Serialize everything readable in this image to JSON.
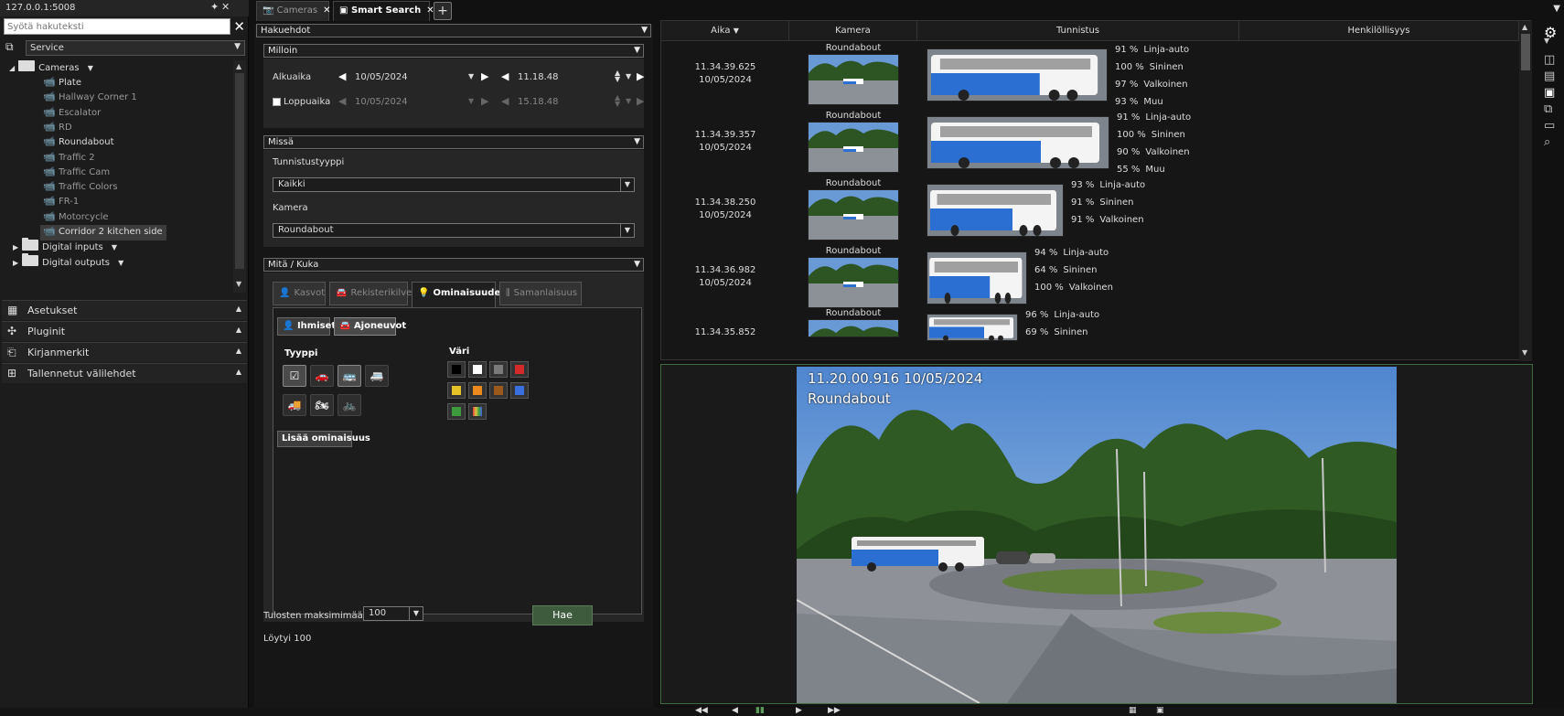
{
  "left": {
    "server": "127.0.0.1:5008",
    "search_placeholder": "Syötä hakuteksti",
    "service": "Service",
    "tree": {
      "cameras_folder": "Cameras",
      "cameras": [
        {
          "label": "Plate",
          "dim": false
        },
        {
          "label": "Hallway Corner 1",
          "dim": true
        },
        {
          "label": "Escalator",
          "dim": true
        },
        {
          "label": "RD",
          "dim": true
        },
        {
          "label": "Roundabout",
          "dim": false
        },
        {
          "label": "Traffic 2",
          "dim": true
        },
        {
          "label": "Traffic Cam",
          "dim": true
        },
        {
          "label": "Traffic Colors",
          "dim": true
        },
        {
          "label": "FR-1",
          "dim": true
        },
        {
          "label": "Motorcycle",
          "dim": true
        },
        {
          "label": "Corridor 2 kitchen side",
          "dim": false
        }
      ],
      "digital_inputs": "Digital inputs",
      "digital_outputs": "Digital outputs"
    },
    "accordions": [
      "Asetukset",
      "Pluginit",
      "Kirjanmerkit",
      "Tallennetut välilehdet"
    ]
  },
  "tabs": [
    {
      "label": "Cameras"
    },
    {
      "label": "Smart Search"
    }
  ],
  "criteria": {
    "header": "Hakuehdot",
    "when": {
      "title": "Milloin",
      "start_label": "Alkuaika",
      "start_date": "10/05/2024",
      "start_time": "11.18.48",
      "end_label": "Loppuaika",
      "end_date": "10/05/2024",
      "end_time": "15.18.48"
    },
    "where": {
      "title": "Missä",
      "type_label": "Tunnistustyyppi",
      "type_value": "Kaikki",
      "camera_label": "Kamera",
      "camera_value": "Roundabout"
    },
    "what": {
      "title": "Mitä / Kuka",
      "tabs": [
        "Kasvot",
        "Rekisterikilvet",
        "Ominaisuudet",
        "Samanlaisuus"
      ],
      "people_btn": "Ihmiset",
      "vehicles_btn": "Ajoneuvot",
      "type_label": "Tyyppi",
      "color_label": "Väri",
      "colors": [
        "#000000",
        "#ffffff",
        "#7a7a7a",
        "#d42a2a",
        "#e6c428",
        "#ec8a1e",
        "#9a5a1e",
        "#3a6fe0",
        "#3d9a3d"
      ],
      "add_attr": "Lisää ominaisuus"
    },
    "max_label": "Tulosten maksimimäärä",
    "max_value": "100",
    "search_btn": "Hae",
    "found": "Löytyi 100"
  },
  "results": {
    "columns": [
      "Aika",
      "Kamera",
      "Tunnistus",
      "Henkilöllisyys"
    ],
    "rows": [
      {
        "time": "11.34.39.625",
        "date": "10/05/2024",
        "camera": "Roundabout",
        "dets": [
          {
            "pct": "91 %",
            "label": "Linja-auto"
          },
          {
            "pct": "100 %",
            "label": "Sininen"
          },
          {
            "pct": "97 %",
            "label": "Valkoinen"
          },
          {
            "pct": "93 %",
            "label": "Muu"
          }
        ]
      },
      {
        "time": "11.34.39.357",
        "date": "10/05/2024",
        "camera": "Roundabout",
        "dets": [
          {
            "pct": "91 %",
            "label": "Linja-auto"
          },
          {
            "pct": "100 %",
            "label": "Sininen"
          },
          {
            "pct": "90 %",
            "label": "Valkoinen"
          },
          {
            "pct": "55 %",
            "label": "Muu"
          }
        ]
      },
      {
        "time": "11.34.38.250",
        "date": "10/05/2024",
        "camera": "Roundabout",
        "dets": [
          {
            "pct": "93 %",
            "label": "Linja-auto"
          },
          {
            "pct": "91 %",
            "label": "Sininen"
          },
          {
            "pct": "91 %",
            "label": "Valkoinen"
          }
        ]
      },
      {
        "time": "11.34.36.982",
        "date": "10/05/2024",
        "camera": "Roundabout",
        "dets": [
          {
            "pct": "94 %",
            "label": "Linja-auto"
          },
          {
            "pct": "64 %",
            "label": "Sininen"
          },
          {
            "pct": "100 %",
            "label": "Valkoinen"
          }
        ]
      },
      {
        "time": "11.34.35.852",
        "date": "",
        "camera": "Roundabout",
        "dets": [
          {
            "pct": "96 %",
            "label": "Linja-auto"
          },
          {
            "pct": "69 %",
            "label": "Sininen"
          }
        ]
      }
    ]
  },
  "video": {
    "timestamp": "11.20.00.916  10/05/2024",
    "camera": "Roundabout"
  }
}
